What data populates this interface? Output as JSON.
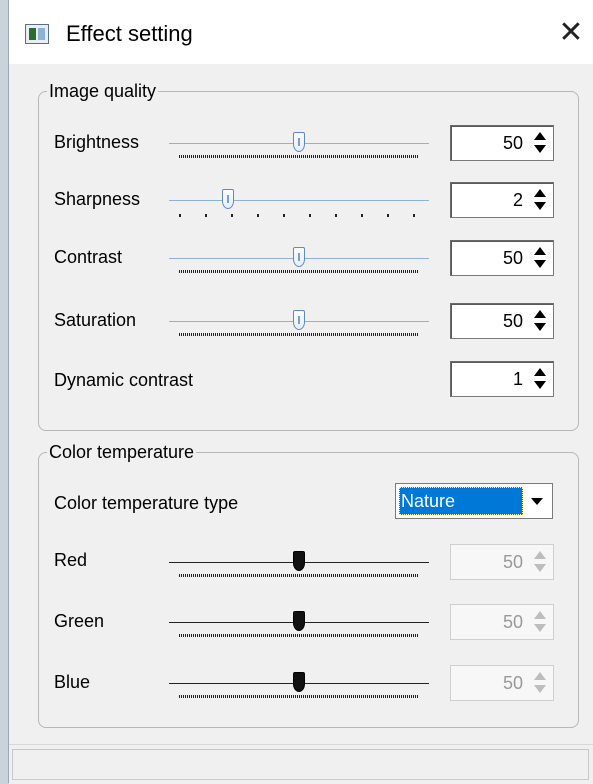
{
  "window": {
    "title": "Effect setting"
  },
  "image_quality": {
    "legend": "Image quality",
    "rows": [
      {
        "label": "Brightness",
        "value": "50",
        "level_percent": 50
      },
      {
        "label": "Sharpness",
        "value": "2",
        "level_percent": 20
      },
      {
        "label": "Contrast",
        "value": "50",
        "level_percent": 50
      },
      {
        "label": "Saturation",
        "value": "50",
        "level_percent": 50
      }
    ],
    "dynamic_contrast": {
      "label": "Dynamic contrast",
      "value": "1"
    }
  },
  "color_temperature": {
    "legend": "Color temperature",
    "type": {
      "label": "Color temperature type",
      "selected": "Nature"
    },
    "rows": [
      {
        "label": "Red",
        "value": "50",
        "level_percent": 50
      },
      {
        "label": "Green",
        "value": "50",
        "level_percent": 50
      },
      {
        "label": "Blue",
        "value": "50",
        "level_percent": 50
      }
    ]
  }
}
